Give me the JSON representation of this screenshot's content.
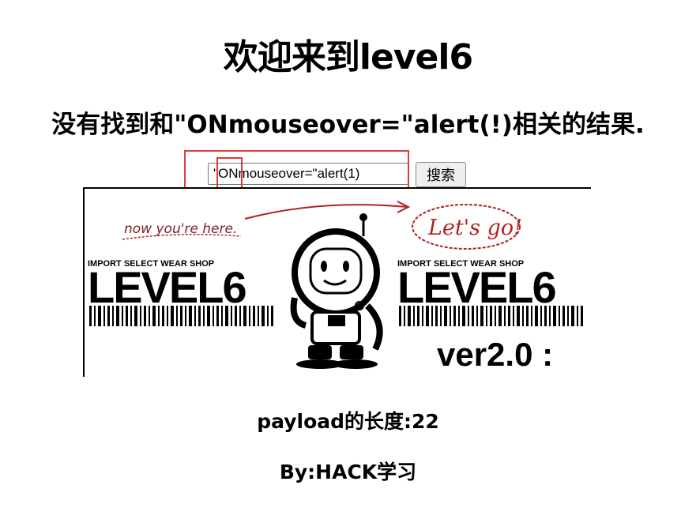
{
  "heading": "欢迎来到level6",
  "result_text": "没有找到和\"ONmouseover=\"alert(!)相关的结果.",
  "search": {
    "value": "\"ONmouseover=\"alert(1)",
    "button_label": "搜索"
  },
  "banner": {
    "now_text": "now you're here.",
    "lets_go_text": "Let's go!",
    "shop_text": "IMPORT SELECT WEAR SHOP",
    "level_text": "LEVEL6",
    "version_text": "ver2.0 :"
  },
  "payload_length": "payload的长度:22",
  "by_text": "By:HACK学习",
  "colors": {
    "highlight": "#e03b3b",
    "ink": "#000000",
    "scribble": "#b22222"
  }
}
